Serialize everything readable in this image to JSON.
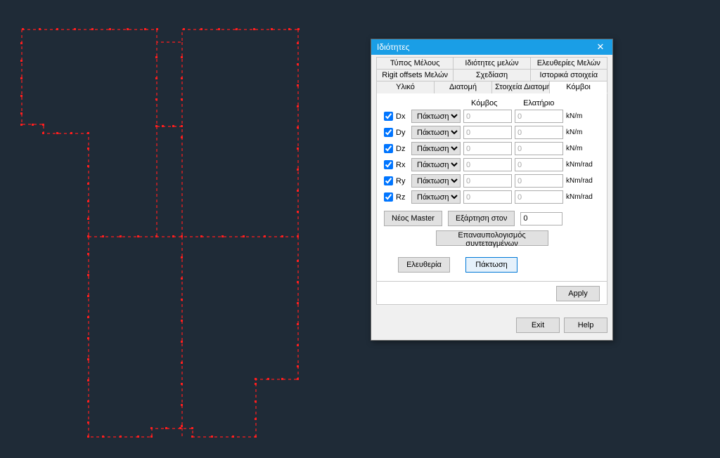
{
  "dialog": {
    "title": "Ιδιότητες",
    "tabs": {
      "row1": [
        "Τύπος Μέλους",
        "Ιδιότητες μελών",
        "Ελευθερίες Μελών"
      ],
      "row2": [
        "Rigit offsets Μελών",
        "Σχεδίαση",
        "Ιστορικά στοιχεία"
      ],
      "row3": [
        "Υλικό",
        "Διατομή",
        "Στοιχεία Διατομής",
        "Κόμβοι"
      ]
    },
    "columns": {
      "a": "Κόμβος",
      "b": "Ελατήριο"
    },
    "rows": [
      {
        "id": "Dx",
        "checked": true,
        "mode": "Πάκτωση",
        "v1": "0",
        "v2": "0",
        "unit": "kN/m"
      },
      {
        "id": "Dy",
        "checked": true,
        "mode": "Πάκτωση",
        "v1": "0",
        "v2": "0",
        "unit": "kN/m"
      },
      {
        "id": "Dz",
        "checked": true,
        "mode": "Πάκτωση",
        "v1": "0",
        "v2": "0",
        "unit": "kN/m"
      },
      {
        "id": "Rx",
        "checked": true,
        "mode": "Πάκτωση",
        "v1": "0",
        "v2": "0",
        "unit": "kNm/rad"
      },
      {
        "id": "Ry",
        "checked": true,
        "mode": "Πάκτωση",
        "v1": "0",
        "v2": "0",
        "unit": "kNm/rad"
      },
      {
        "id": "Rz",
        "checked": true,
        "mode": "Πάκτωση",
        "v1": "0",
        "v2": "0",
        "unit": "kNm/rad"
      }
    ],
    "new_master": "Νέος Master",
    "depend_label": "Εξάρτηση στον",
    "depend_value": "0",
    "recalc": "Επαναυπολογισμός συντεταγμένων",
    "free": "Ελευθερία",
    "fix": "Πάκτωση",
    "apply": "Apply",
    "exit": "Exit",
    "help": "Help"
  },
  "colors": {
    "canvas_bg": "#1f2b37",
    "plan_stroke": "#ff1e1e",
    "titlebar": "#1a9ee6"
  }
}
